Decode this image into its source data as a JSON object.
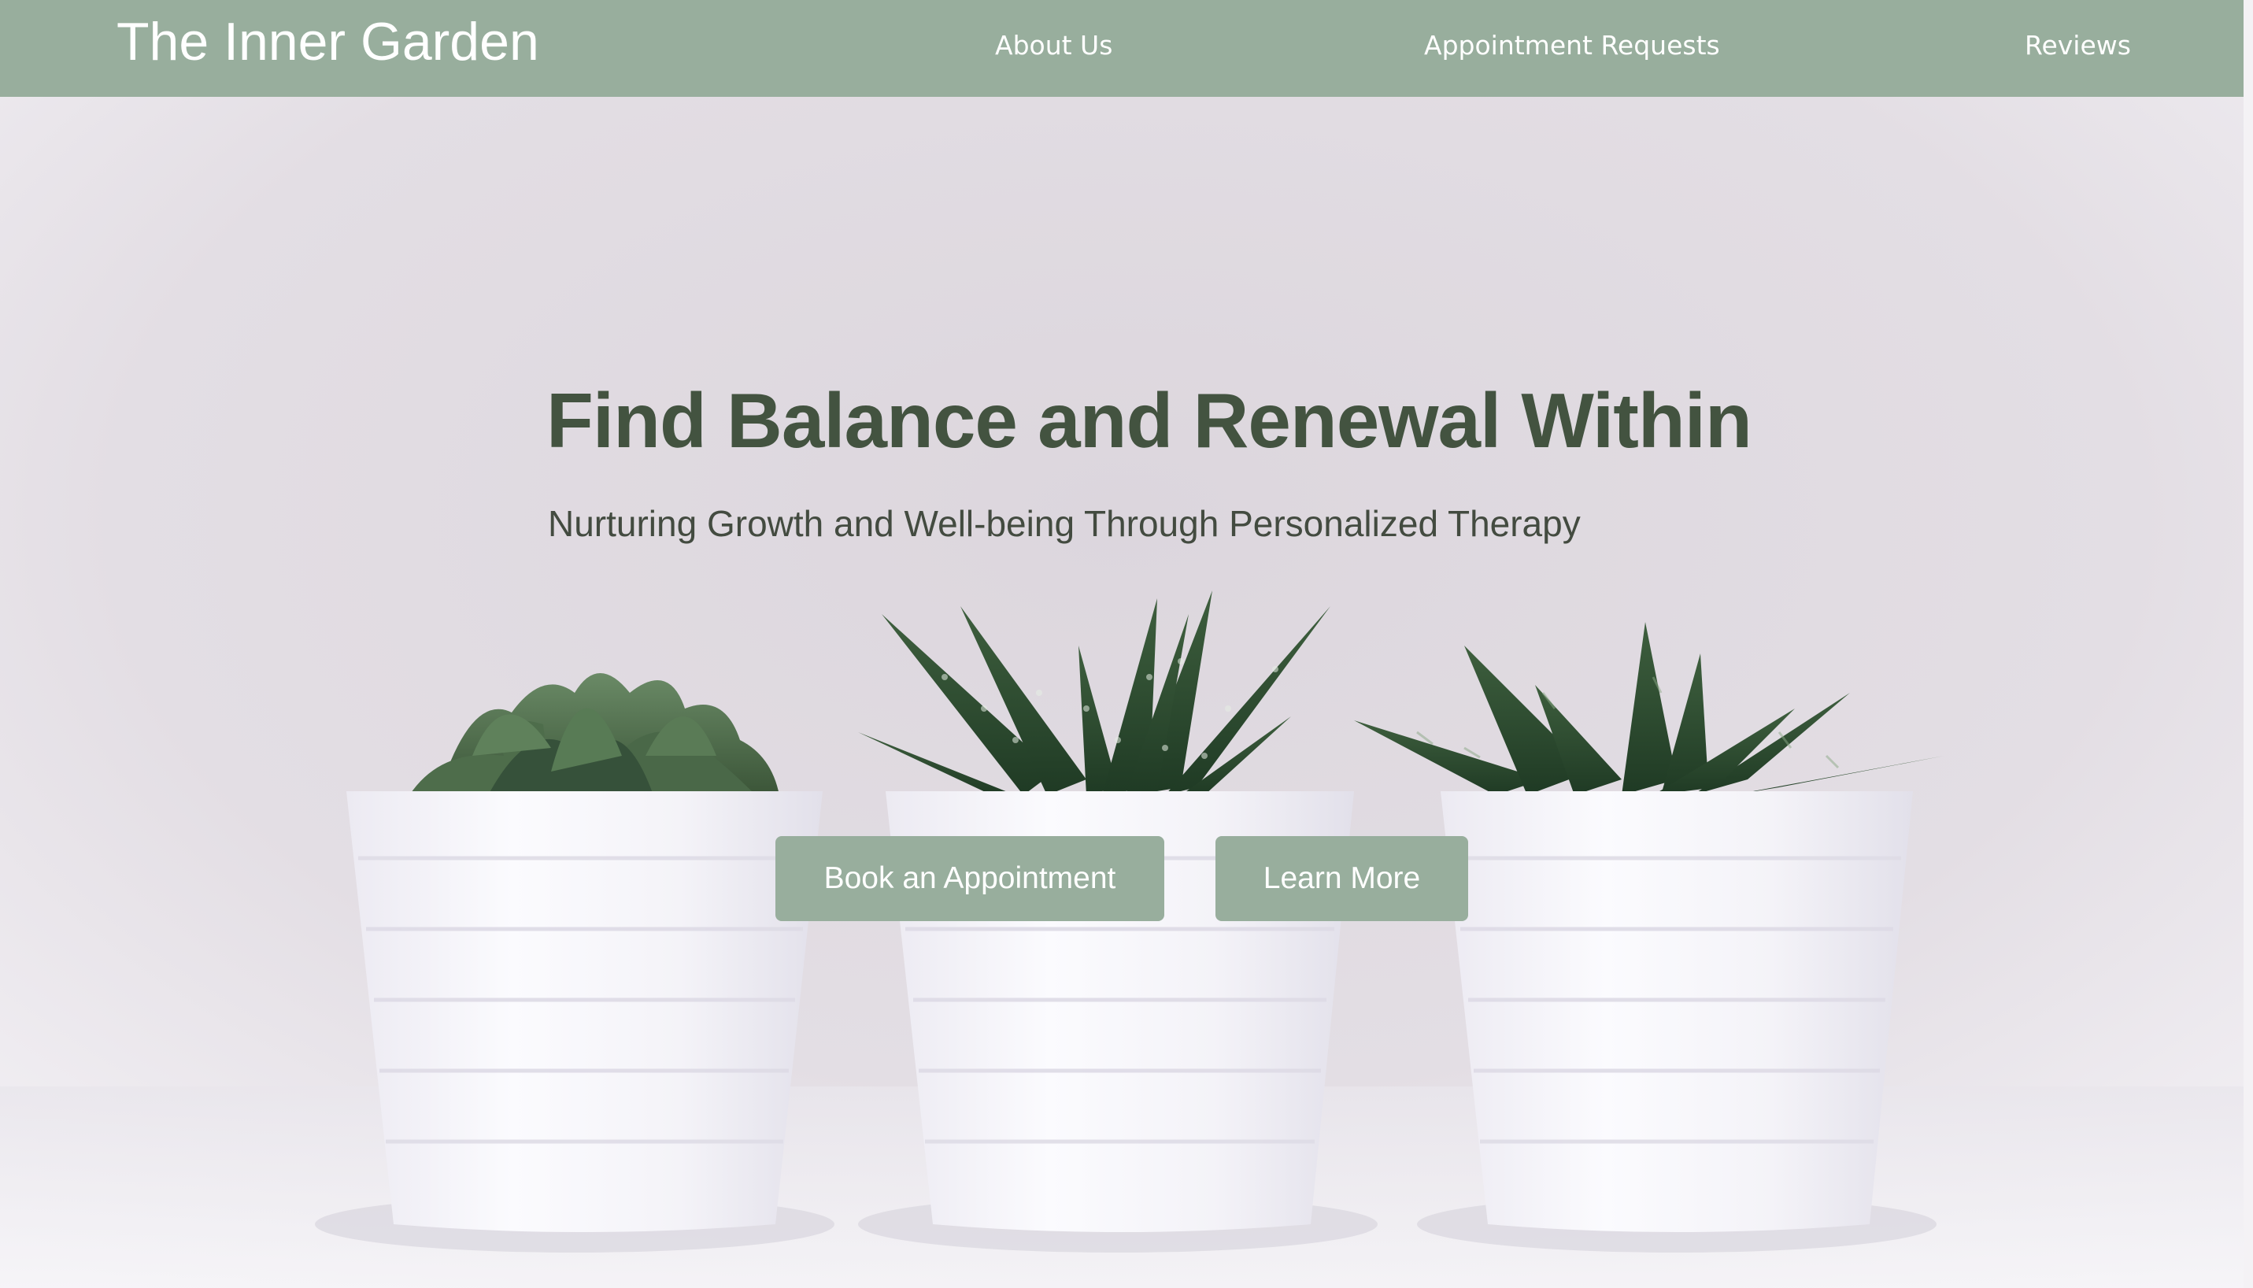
{
  "header": {
    "brand": "The Inner Garden",
    "nav": [
      "About Us",
      "Appointment Requests",
      "Reviews"
    ]
  },
  "hero": {
    "title": "Find Balance and Renewal Within",
    "subtitle": "Nurturing Growth and Well-being Through Personalized Therapy",
    "primary_button": "Book an Appointment",
    "secondary_button": "Learn More"
  },
  "colors": {
    "nav_background": "#98ae9d",
    "button_background": "#98ae9d",
    "headline_text": "#435340",
    "background": "#e2dde2"
  },
  "icons": [
    "succulent-plant-image"
  ]
}
